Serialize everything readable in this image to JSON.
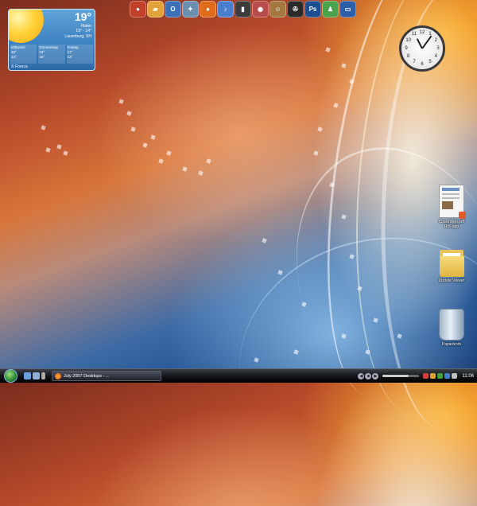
{
  "weather": {
    "temperature": "19°",
    "condition": "Heiter",
    "range": "19° - 14°",
    "location": "Lauenburg, SH",
    "forecast": [
      {
        "day": "Mittwoch",
        "high": "20°",
        "low": "14°"
      },
      {
        "day": "Donnerstag",
        "high": "23°",
        "low": "15°"
      },
      {
        "day": "Freitag",
        "high": "17°",
        "low": "12°"
      }
    ],
    "provider": "© Foreca"
  },
  "launcher": {
    "items": [
      {
        "icon": "app-red-circle-icon",
        "color": "#c0402a",
        "glyph": "●"
      },
      {
        "icon": "folder-icon",
        "color": "#e1a23a",
        "glyph": "▰"
      },
      {
        "icon": "outlook-icon",
        "color": "#3b6fb6",
        "glyph": "O"
      },
      {
        "icon": "network-icon",
        "color": "#6c8fb0",
        "glyph": "✦"
      },
      {
        "icon": "firefox-icon",
        "color": "#e06b1a",
        "glyph": "●"
      },
      {
        "icon": "itunes-icon",
        "color": "#4a7fd0",
        "glyph": "♪"
      },
      {
        "icon": "phone-icon",
        "color": "#3c3c3c",
        "glyph": "▮"
      },
      {
        "icon": "game-icon",
        "color": "#b84b4b",
        "glyph": "◉"
      },
      {
        "icon": "monkey-icon",
        "color": "#a27740",
        "glyph": "☺"
      },
      {
        "icon": "film-reel-icon",
        "color": "#2a2a2a",
        "glyph": "✇"
      },
      {
        "icon": "photoshop-icon",
        "color": "#1d4e8f",
        "glyph": "Ps"
      },
      {
        "icon": "messenger-icon",
        "color": "#4aa24a",
        "glyph": "♟"
      },
      {
        "icon": "computer-icon",
        "color": "#2d5fa8",
        "glyph": "▭"
      }
    ]
  },
  "clock": {
    "numbers": [
      "12",
      "1",
      "2",
      "3",
      "4",
      "5",
      "6",
      "7",
      "8",
      "9",
      "10",
      "11"
    ],
    "hour": 11,
    "minute": 6
  },
  "desktop_icons": [
    {
      "name": "desktop-icon-file",
      "label": "iStockWeb.pdf\nRöll.app"
    },
    {
      "name": "desktop-icon-folder",
      "label": "Update Viewer"
    },
    {
      "name": "desktop-icon-recycle-bin",
      "label": "Papierkorb"
    }
  ],
  "taskbar": {
    "task_label": "July 2007 Desktops - ...",
    "volume_level": 0.7,
    "media": [
      "◀",
      "■",
      "▶"
    ],
    "time": "11:06"
  }
}
